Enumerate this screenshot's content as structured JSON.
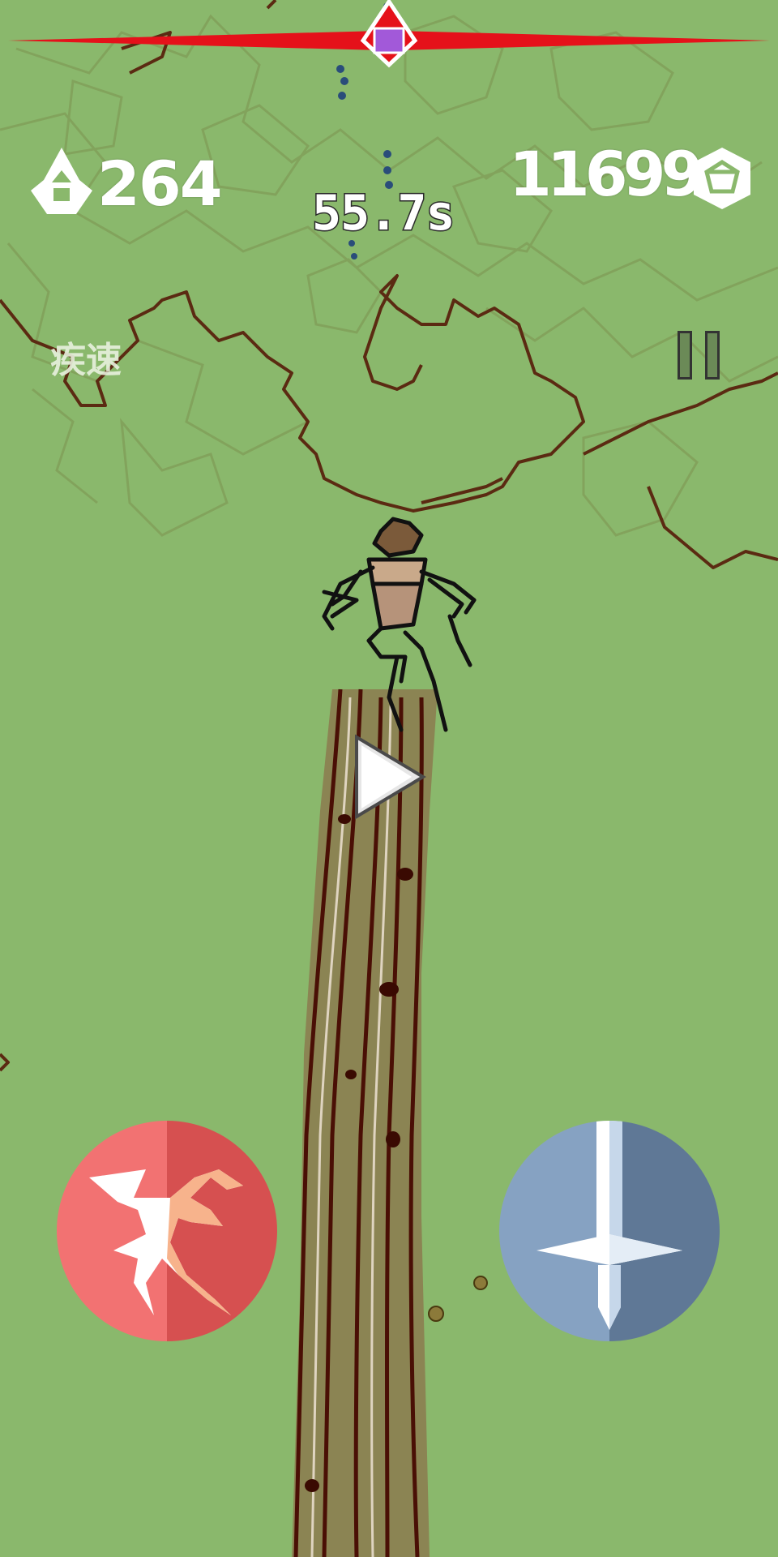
{
  "hud": {
    "shuriken_count": "264",
    "coin_count": "11699",
    "timer": "55.7s",
    "speed_label": "疾速",
    "level_progress": 0.5
  },
  "icons": {
    "shuriken": "shuriken-icon",
    "coin": "hex-coin-icon",
    "pause": "pause-icon",
    "play": "play-icon",
    "dash": "dash-ninja-icon",
    "attack": "sword-icon"
  },
  "colors": {
    "background": "#8ab86c",
    "progress_red": "#e5111a",
    "progress_marker": "#a259d9",
    "dash_light": "#f27272",
    "dash_dark": "#d65050",
    "attack_light": "#86a2c2",
    "attack_dark": "#5f7896",
    "outline_brown": "#5b2a12"
  }
}
